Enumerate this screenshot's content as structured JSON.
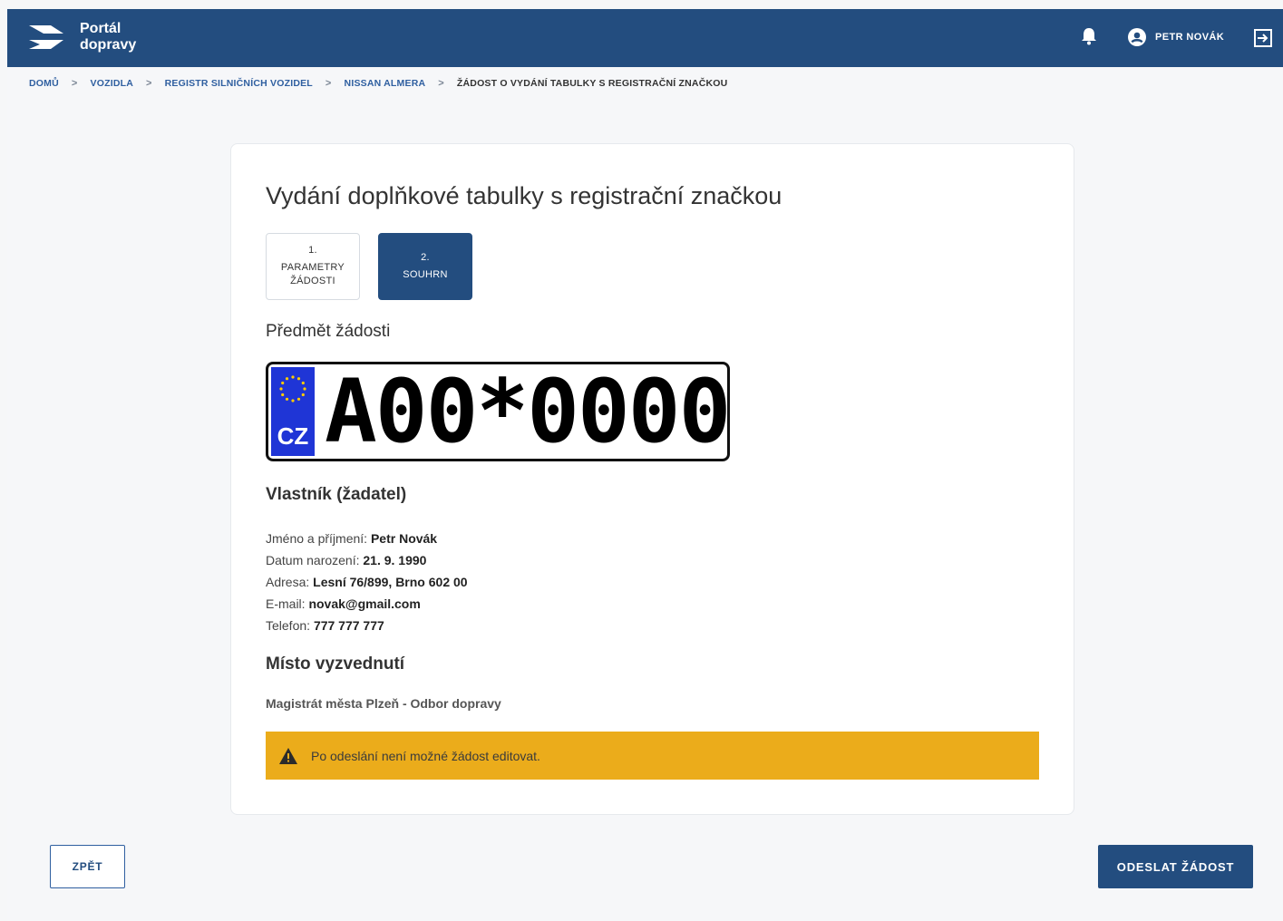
{
  "header": {
    "brand_line1": "Portál",
    "brand_line2": "dopravy",
    "user_name": "PETR NOVÁK",
    "colors": {
      "primary": "#234d7f",
      "warning": "#ebac1b"
    }
  },
  "breadcrumb": {
    "items": [
      "DOMŮ",
      "VOZIDLA",
      "REGISTR SILNIČNÍCH VOZIDEL",
      "NISSAN ALMERA"
    ],
    "current": "ŽÁDOST O VYDÁNÍ TABULKY S REGISTRAČNÍ ZNAČKOU",
    "separator": ">"
  },
  "form": {
    "title": "Vydání doplňkové tabulky s registrační značkou",
    "steps": [
      {
        "number": "1.",
        "label": "PARAMETRY\nŽÁDOSTI",
        "active": false
      },
      {
        "number": "2.",
        "label": "SOUHRN",
        "active": true
      }
    ],
    "subject_heading": "Předmět žádosti",
    "plate": {
      "country": "CZ",
      "text": "A00*0000"
    },
    "owner": {
      "heading": "Vlastník (žadatel)",
      "name_label": "Jméno a příjmení:",
      "name_value": "Petr Novák",
      "birth_label": "Datum narození:",
      "birth_value": "21. 9. 1990",
      "address_label": "Adresa:",
      "address_value": "Lesní 76/899, Brno 602 00",
      "email_label": "E-mail:",
      "email_value": "novak@gmail.com",
      "phone_label": "Telefon:",
      "phone_value": "777 777 777"
    },
    "pickup": {
      "heading": "Místo vyzvednutí",
      "value": "Magistrát města Plzeň - Odbor dopravy"
    },
    "alert": "Po odeslání není možné žádost editovat."
  },
  "actions": {
    "back": "ZPĚT",
    "submit": "ODESLAT ŽÁDOST"
  },
  "icons": [
    "logo-icon",
    "bell-icon",
    "user-avatar-icon",
    "logout-icon",
    "eu-stars-icon",
    "warning-icon"
  ]
}
